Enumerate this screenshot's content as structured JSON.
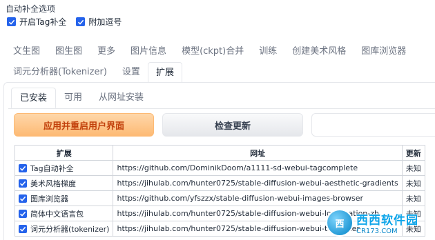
{
  "autocomplete_section": {
    "title": "自动补全选项",
    "options": [
      {
        "label": "开启Tag补全",
        "checked": true
      },
      {
        "label": "附加逗号",
        "checked": true
      }
    ]
  },
  "top_tabs_row1": [
    "文生图",
    "图生图",
    "更多",
    "图片信息",
    "模型(ckpt)合并",
    "训练",
    "创建美术风格",
    "图库浏览器"
  ],
  "top_tabs_row2": [
    "词元分析器(Tokenizer)",
    "设置",
    "扩展"
  ],
  "active_top_tab": "扩展",
  "sub_tabs": [
    "已安装",
    "可用",
    "从网址安装"
  ],
  "active_sub_tab": "已安装",
  "buttons": {
    "apply_restart": "应用并重启用户界面",
    "check_updates": "检查更新"
  },
  "accent_color": "#2563eb",
  "table": {
    "headers": [
      "扩展",
      "网址",
      "更新"
    ],
    "rows": [
      {
        "name": "Tag自动补全",
        "url": "https://github.com/DominikDoom/a1111-sd-webui-tagcomplete",
        "update": "未知",
        "enabled": true
      },
      {
        "name": "美术风格梯度",
        "url": "https://jihulab.com/hunter0725/stable-diffusion-webui-aesthetic-gradients",
        "update": "未知",
        "enabled": true
      },
      {
        "name": "图库浏览器",
        "url": "https://github.com/yfszzx/stable-diffusion-webui-images-browser",
        "update": "未知",
        "enabled": true
      },
      {
        "name": "简体中文语言包",
        "url": "https://jihulab.com/hunter0725/stable-diffusion-webui-localization-zh",
        "update": "未知",
        "enabled": true
      },
      {
        "name": "词元分析器(tokenizer)",
        "url": "https://jihulab.com/hunter0725/stable-diffusion-webui-tokenizer",
        "update": "未知",
        "enabled": true
      }
    ]
  },
  "watermark": {
    "logo_text": "西",
    "brand": "西西软件园",
    "domain": "CR173.COM"
  }
}
